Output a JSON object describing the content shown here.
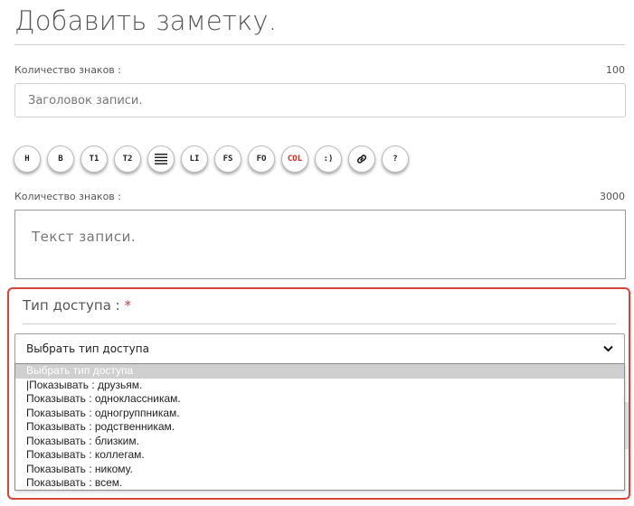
{
  "form": {
    "title": "Добавить заметку.",
    "title_counter_label": "Количество знаков :",
    "title_counter_max": "100",
    "title_placeholder": "Заголовок записи.",
    "text_counter_label": "Количество знаков :",
    "text_counter_max": "3000",
    "text_placeholder": "Текст записи."
  },
  "toolbar": {
    "buttons": [
      {
        "label": "H",
        "icon": ""
      },
      {
        "label": "B",
        "icon": ""
      },
      {
        "label": "T1",
        "icon": ""
      },
      {
        "label": "T2",
        "icon": ""
      },
      {
        "label": "",
        "icon": "align-lines-icon"
      },
      {
        "label": "LI",
        "icon": ""
      },
      {
        "label": "FS",
        "icon": ""
      },
      {
        "label": "FO",
        "icon": ""
      },
      {
        "label": "COL",
        "icon": "",
        "color": "#d62b1f"
      },
      {
        "label": ":)",
        "icon": ""
      },
      {
        "label": "",
        "icon": "link-icon"
      },
      {
        "label": "?",
        "icon": ""
      }
    ]
  },
  "access": {
    "label": "Тип доступа :",
    "required_mark": "*",
    "selected": "Выбрать тип доступа",
    "options": [
      "Выбрать тип доступа",
      "|Показывать : друзьям.",
      "Показывать : одноклассникам.",
      "Показывать : одногруппникам.",
      "Показывать : родственникам.",
      "Показывать : близким.",
      "Показывать : коллегам.",
      "Показывать : никому.",
      "Показывать : всем."
    ],
    "highlight_color": "#d9443a"
  }
}
